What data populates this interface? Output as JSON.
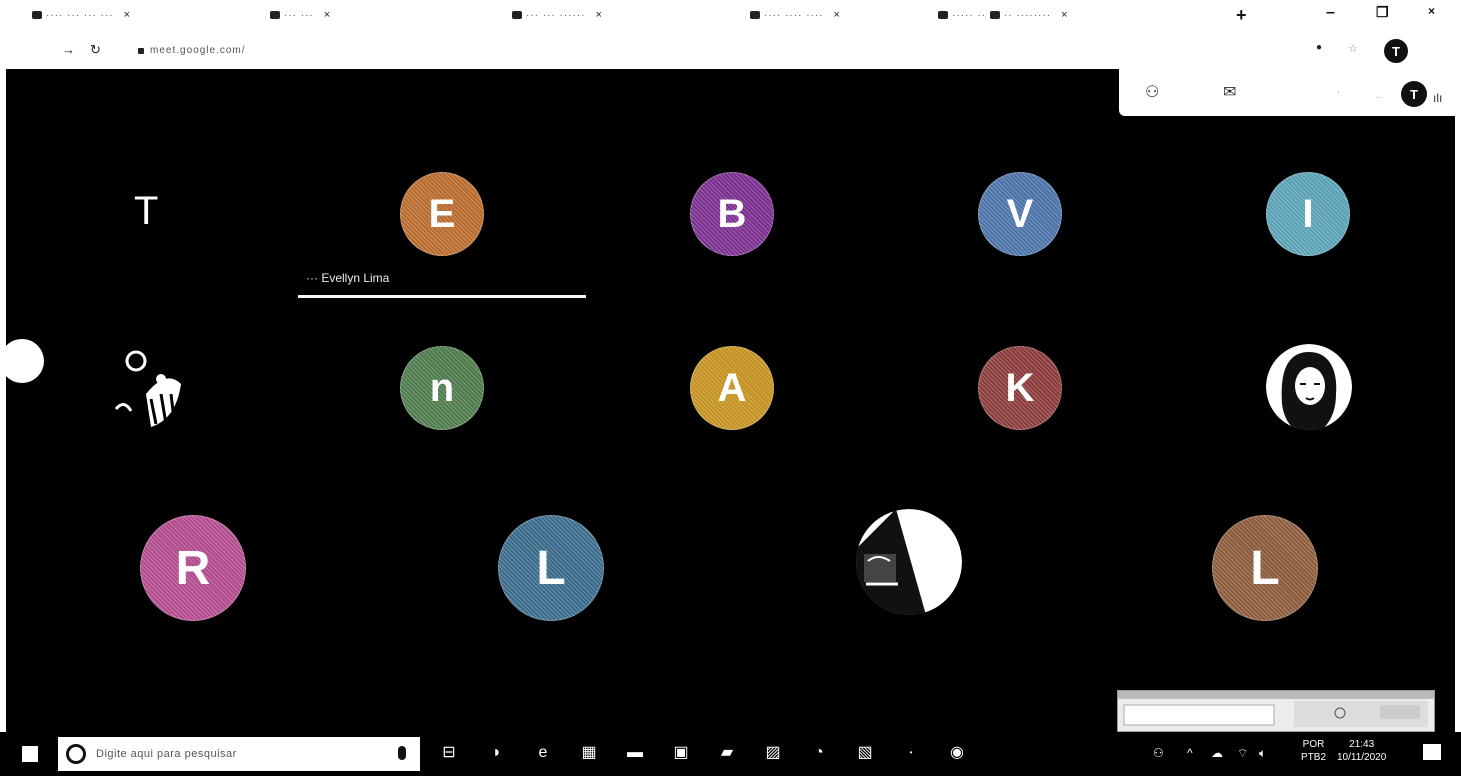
{
  "browser": {
    "tabs": [
      {
        "label": "···· ··· ··· ···"
      },
      {
        "label": "··· ···"
      },
      {
        "label": "··· ··· ······"
      },
      {
        "label": "···· ···· ····"
      },
      {
        "label": "····· ··"
      },
      {
        "label": "··· ···"
      },
      {
        "label": "·· ········"
      }
    ],
    "address": "meet.google.com/"
  },
  "meeting": {
    "tiles": {
      "t1": "T",
      "t2": "E",
      "t3": "B",
      "t4": "V",
      "t5": "I",
      "t7": "n",
      "t8": "A",
      "t9": "K",
      "t11": "R",
      "t12": "L",
      "t14": "L"
    },
    "speaker_label": "···  Evellyn Lima",
    "account_initial": "T"
  },
  "taskbar": {
    "search_placeholder": "Digite aqui para pesquisar",
    "lang_top": "POR",
    "lang_bottom": "PTB2",
    "time": "21:43",
    "date": "10/11/2020"
  },
  "colors": {
    "tile_E": "#b86a2c",
    "tile_B": "#7a2e8e",
    "tile_V": "#4a72a8",
    "tile_I": "#5aa0b4",
    "tile_n": "#4d7a4a",
    "tile_A": "#c49020",
    "tile_K": "#8a3a3a",
    "tile_R": "#b04a8c",
    "tile_L1": "#3a6a8a",
    "tile_L2": "#8a5a3a"
  }
}
